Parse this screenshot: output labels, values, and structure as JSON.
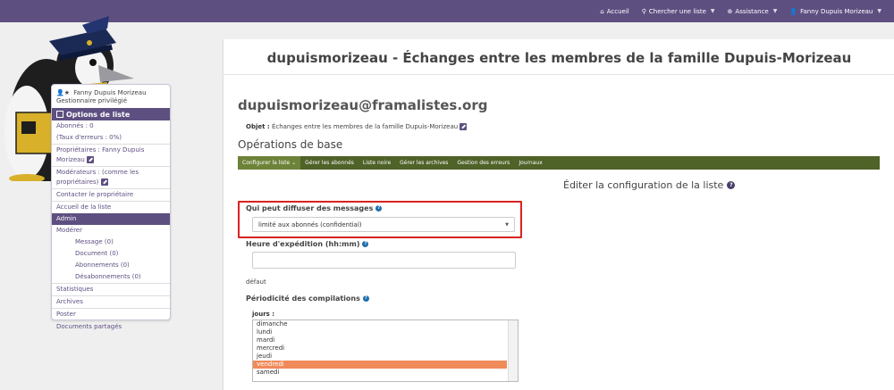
{
  "topnav": {
    "accueil": "Accueil",
    "chercher": "Chercher une liste",
    "assistance": "Assistance",
    "user": "Fanny Dupuis Morizeau"
  },
  "sidebar": {
    "user_name": "Fanny Dupuis Morizeau",
    "user_role": "Gestionnaire privilégié",
    "title": "Options de liste",
    "abonnes": "Abonnés : 0",
    "taux": "(Taux d'erreurs : 0%)",
    "proprietaires_1": "Propriétaires : Fanny Dupuis",
    "proprietaires_2": "Morizeau",
    "moderateurs_1": "Modérateurs : (comme les",
    "moderateurs_2": "propriétaires)",
    "contacter": "Contacter le propriétaire",
    "accueil_liste": "Accueil de la liste",
    "admin": "Admin",
    "moderer": "Modérer",
    "message": "Message (0)",
    "document": "Document (0)",
    "abonnements": "Abonnements (0)",
    "desabonnements": "Désabonnements (0)",
    "statistiques": "Statistiques",
    "archives": "Archives",
    "poster": "Poster",
    "documents_partages": "Documents partagés"
  },
  "main": {
    "page_title": "dupuismorizeau - Échanges entre les membres de la famille Dupuis-Morizeau",
    "list_email": "dupuismorizeau@framalistes.org",
    "objet_label": "Objet :",
    "objet_value": "Échanges entre les membres de la famille Dupuis-Morizeau",
    "ops_title": "Opérations de base",
    "tabs": [
      {
        "label": "Configurer la liste"
      },
      {
        "label": "Gérer les abonnés"
      },
      {
        "label": "Liste noire"
      },
      {
        "label": "Gérer les archives"
      },
      {
        "label": "Gestion des erreurs"
      },
      {
        "label": "Journaux"
      }
    ],
    "cfg_title": "Éditer la configuration de la liste",
    "qui_peut_label": "Qui peut diffuser des messages",
    "qui_peut_value": "limité aux abonnés (confidential)",
    "heure_label": "Heure d'expédition (hh:mm)",
    "defaut": "défaut",
    "periodicite_label": "Périodicité des compilations",
    "jours_label": "jours :",
    "jours": [
      "dimanche",
      "lundi",
      "mardi",
      "mercredi",
      "jeudi",
      "vendredi",
      "samedi"
    ],
    "jours_selected": "vendredi"
  },
  "colors": {
    "topbar": "#5e4f81",
    "tabbar": "#4f6228",
    "highlight_border": "#d9231e",
    "selected_option": "#f08a5a"
  }
}
